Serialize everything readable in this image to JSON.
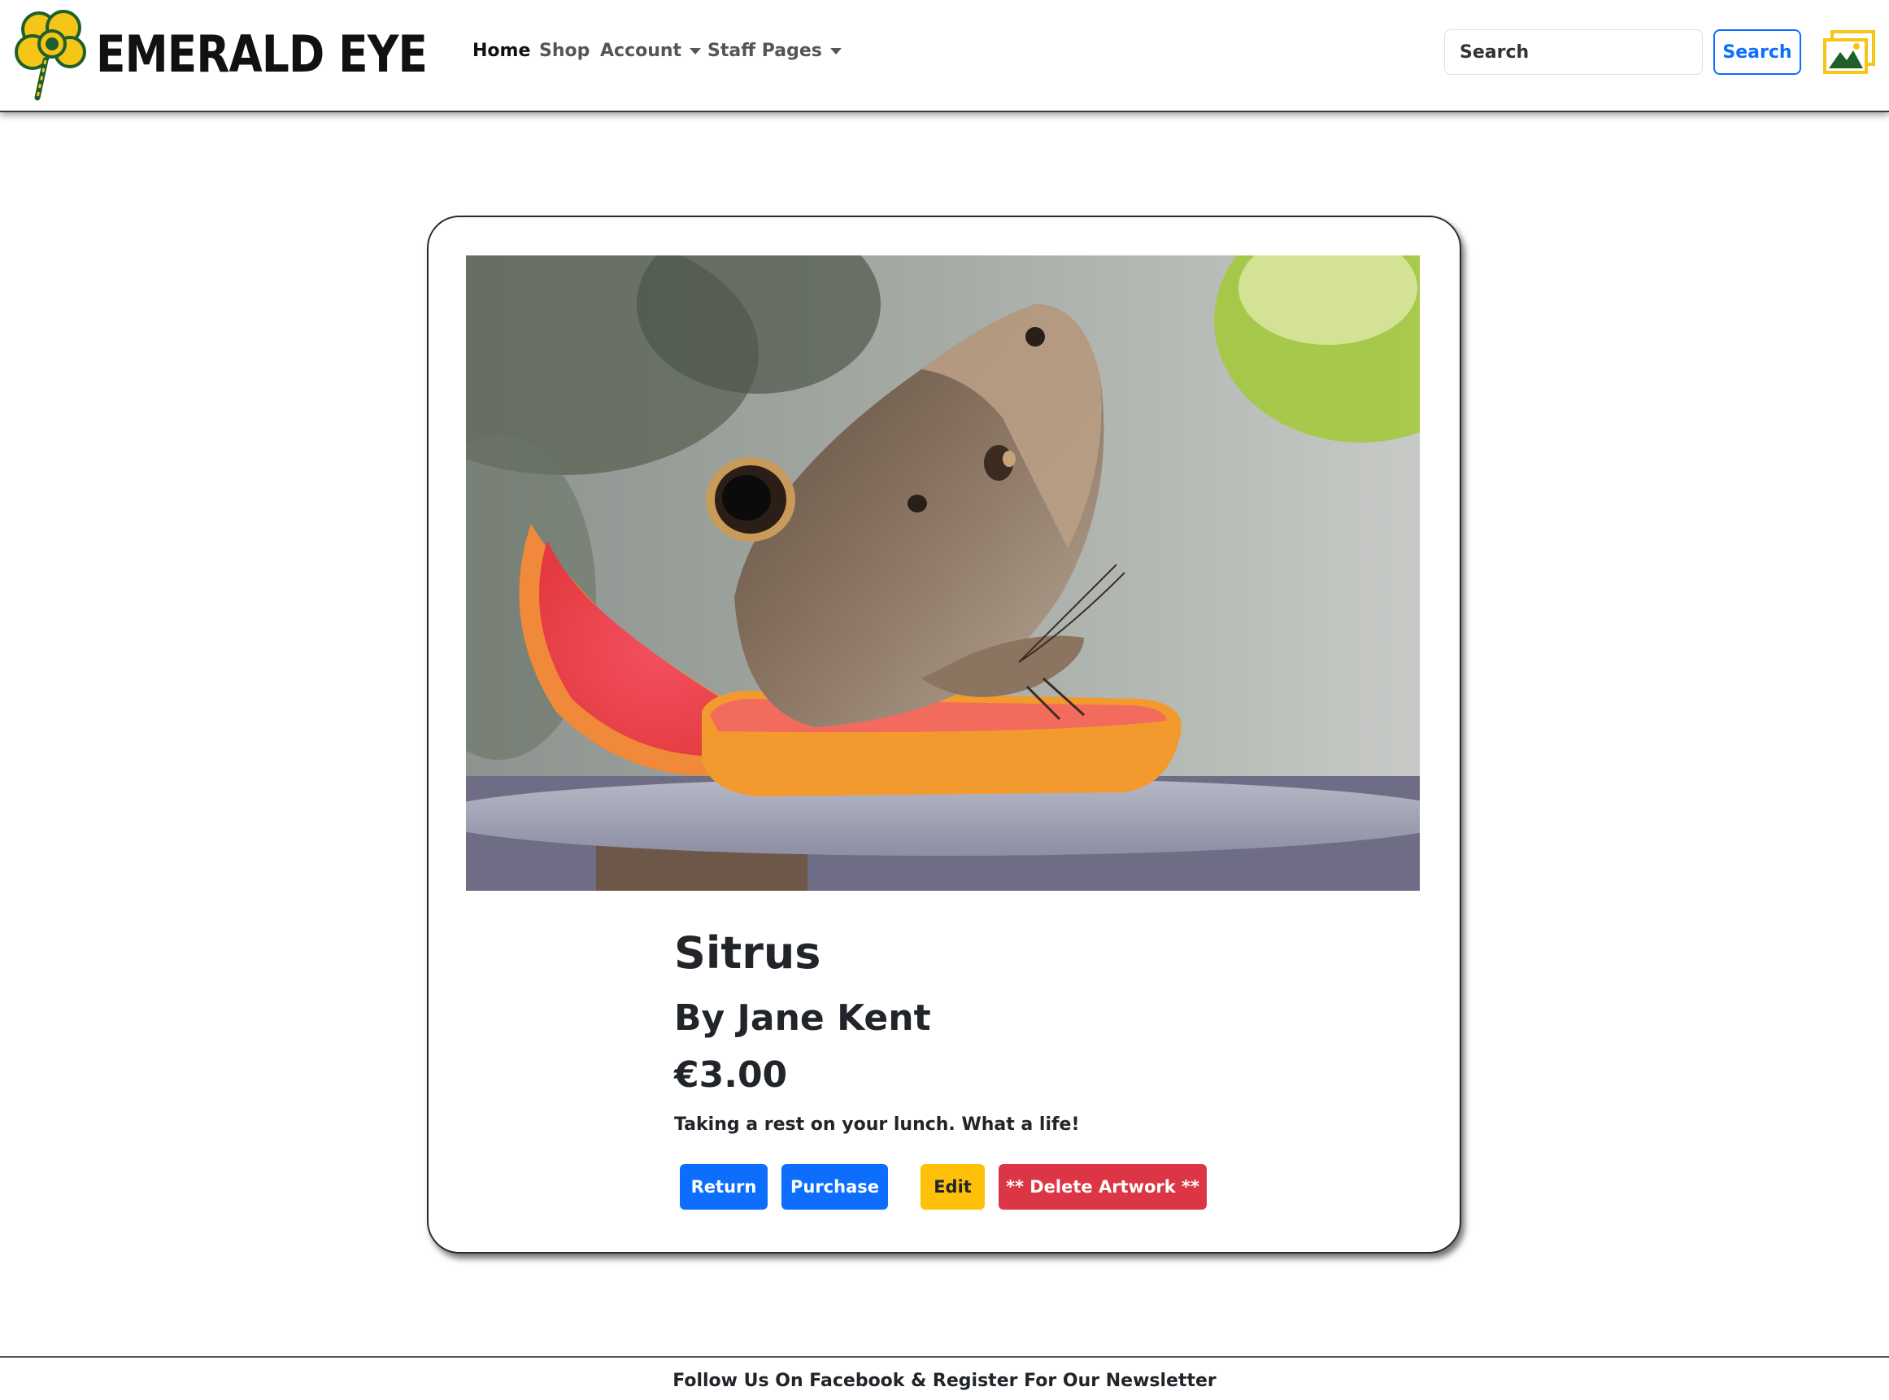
{
  "brand": {
    "name": "EMERALD EYE",
    "logo_icon": "clover-logo-icon"
  },
  "nav": {
    "home": "Home",
    "shop": "Shop",
    "account": "Account",
    "staff_pages": "Staff Pages"
  },
  "search": {
    "placeholder": "Search",
    "button_label": "Search"
  },
  "header_icon": "gallery-icon",
  "artwork": {
    "title": "Sitrus",
    "artist": "By Jane Kent",
    "price": "€3.00",
    "description": "Taking a rest on your lunch. What a life!",
    "image": "butterfly on grapefruit slice photo"
  },
  "actions": {
    "return_label": "Return",
    "purchase_label": "Purchase",
    "edit_label": "Edit",
    "delete_label": "** Delete Artwork **"
  },
  "footer": {
    "text": "Follow Us On Facebook & Register For Our Newsletter"
  },
  "colors": {
    "primary": "#0d6efd",
    "warning": "#ffc107",
    "danger": "#dc3545",
    "logo_yellow": "#f5c518",
    "logo_green": "#1f5f2a"
  }
}
